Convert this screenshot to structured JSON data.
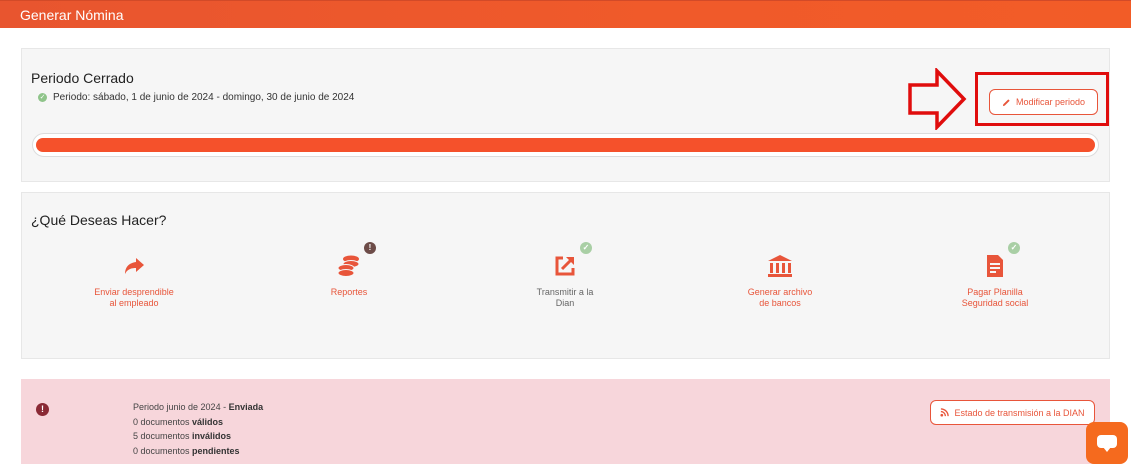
{
  "header": {
    "title": "Generar Nómina"
  },
  "period": {
    "status_title": "Periodo Cerrado",
    "range_text": "Periodo: sábado, 1 de junio de 2024 - domingo, 30 de junio de 2024",
    "modify_label": "Modificar periodo",
    "progress": 1.0
  },
  "actions": {
    "title": "¿Qué Deseas Hacer?",
    "items": [
      {
        "line1": "Enviar desprendible",
        "line2": "al empleado",
        "icon": "share-arrow-icon"
      },
      {
        "line1": "Reportes",
        "line2": "",
        "icon": "coins-stack-icon",
        "badge": "!"
      },
      {
        "line1": "Transmitir a la",
        "line2": "Dian",
        "icon": "external-link-icon",
        "badge": "✓"
      },
      {
        "line1": "Generar archivo",
        "line2": "de bancos",
        "icon": "bank-icon"
      },
      {
        "line1": "Pagar Planilla",
        "line2": "Seguridad social",
        "icon": "document-icon",
        "badge": "✓"
      }
    ]
  },
  "status": {
    "l1_prefix": "Periodo junio de 2024 - ",
    "l1_bold": "Enviada",
    "l2_prefix": "0 documentos ",
    "l2_bold": "válidos",
    "l3_prefix": "5 documentos ",
    "l3_bold": "inválidos",
    "l4_prefix": "0 documentos ",
    "l4_bold": "pendientes",
    "dian_button": "Estado de transmisión a la DIAN"
  },
  "colors": {
    "accent": "#e8553a",
    "highlight": "#e00d0d",
    "alert_bg": "#f7d6db"
  }
}
